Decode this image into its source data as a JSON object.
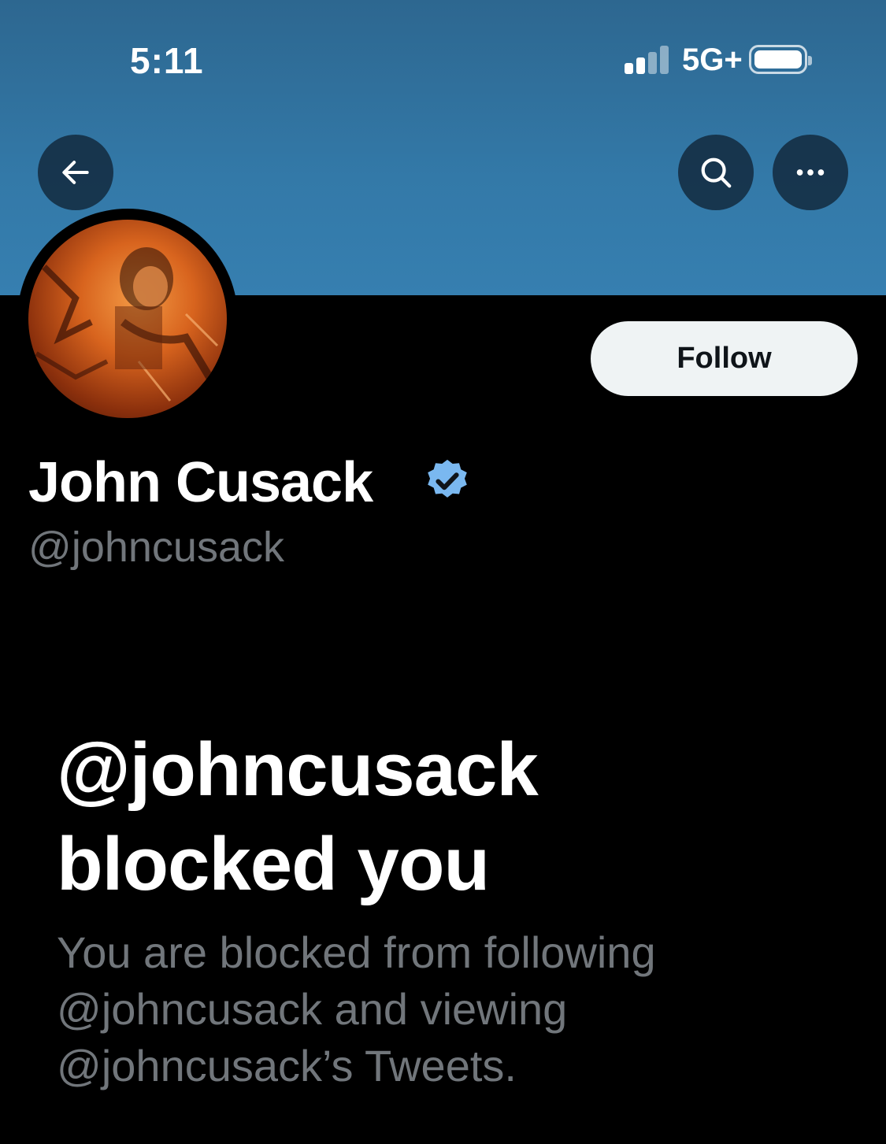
{
  "status_bar": {
    "time": "5:11",
    "network": "5G+"
  },
  "nav": {
    "back_icon": "arrow-left-icon",
    "search_icon": "search-icon",
    "more_icon": "more-horizontal-icon"
  },
  "profile": {
    "display_name": "John Cusack",
    "handle": "@johncusack",
    "verified": true,
    "follow_label": "Follow"
  },
  "blocked": {
    "title": "@johncusack blocked you",
    "description": "You are blocked from following @johncusack and viewing @johncusack’s Tweets."
  },
  "colors": {
    "banner": "#3379a8",
    "verified_badge": "#7ab8f0",
    "muted_text": "#71767b",
    "follow_bg": "#eff3f4"
  }
}
